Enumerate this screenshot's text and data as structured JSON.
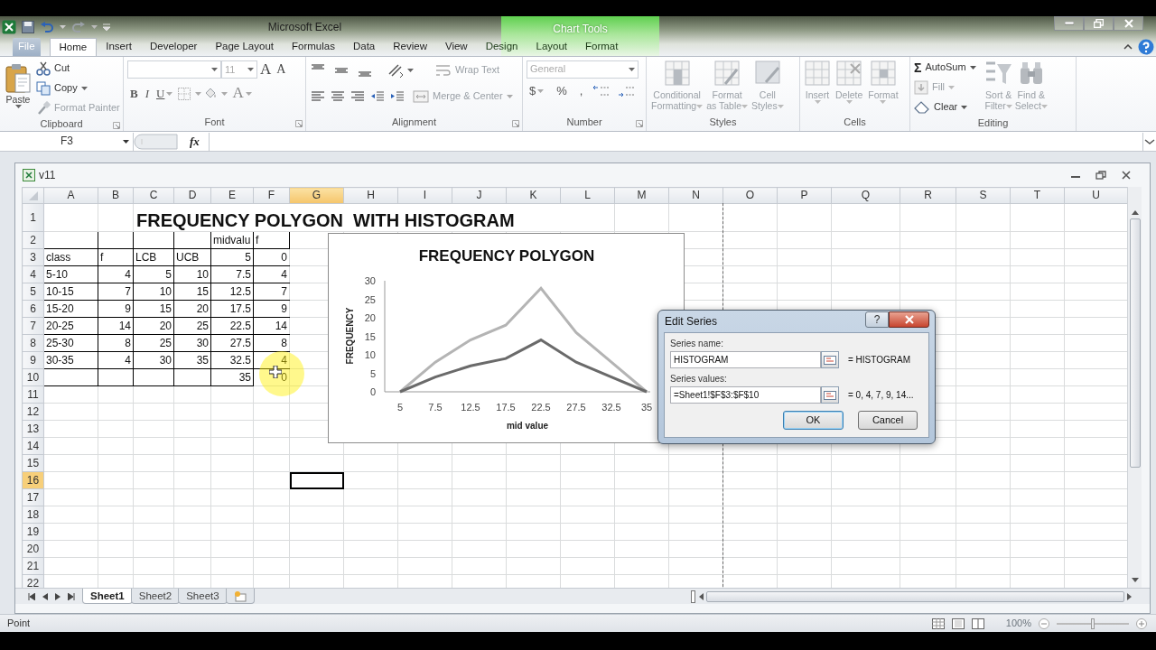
{
  "app_window": {
    "title": "Microsoft Excel",
    "context_group": "Chart Tools"
  },
  "ribbon_tabs": [
    {
      "label": "File",
      "kind": "file",
      "selected": false
    },
    {
      "label": "Home",
      "kind": "tab",
      "selected": true
    },
    {
      "label": "Insert",
      "kind": "tab",
      "selected": false
    },
    {
      "label": "Developer",
      "kind": "tab",
      "selected": false
    },
    {
      "label": "Page Layout",
      "kind": "tab",
      "selected": false
    },
    {
      "label": "Formulas",
      "kind": "tab",
      "selected": false
    },
    {
      "label": "Data",
      "kind": "tab",
      "selected": false
    },
    {
      "label": "Review",
      "kind": "tab",
      "selected": false
    },
    {
      "label": "View",
      "kind": "tab",
      "selected": false
    },
    {
      "label": "Design",
      "kind": "contextual",
      "selected": false
    },
    {
      "label": "Layout",
      "kind": "contextual",
      "selected": false
    },
    {
      "label": "Format",
      "kind": "contextual",
      "selected": false
    }
  ],
  "ribbon_groups": [
    {
      "kind": "clipboard",
      "label": "Clipboard",
      "items": [
        {
          "label": "Paste",
          "disabled": false
        },
        {
          "label": "Cut",
          "disabled": false
        },
        {
          "label": "Copy",
          "disabled": false
        },
        {
          "label": "Format Painter",
          "disabled": true
        }
      ]
    },
    {
      "kind": "font",
      "label": "Font",
      "font_size": "11",
      "items": [
        {
          "label": "A",
          "kind": "grow"
        },
        {
          "label": "A",
          "kind": "shrink"
        },
        {
          "label": "B",
          "kind": "bold"
        },
        {
          "label": "I",
          "kind": "italic"
        },
        {
          "label": "U",
          "kind": "underline"
        },
        {
          "label": "A",
          "kind": "color"
        }
      ]
    },
    {
      "kind": "alignment",
      "label": "Alignment",
      "items": [
        {
          "label": "Wrap Text",
          "disabled": true
        },
        {
          "label": "Merge & Center",
          "disabled": true
        }
      ]
    },
    {
      "kind": "number",
      "label": "Number",
      "format": "General",
      "items": [
        {
          "label": "$"
        },
        {
          "label": "%"
        },
        {
          "label": ","
        }
      ]
    },
    {
      "kind": "styles",
      "label": "Styles",
      "items": [
        {
          "label": "Conditional\nFormatting",
          "disabled": true
        },
        {
          "label": "Format\nas Table",
          "disabled": true
        },
        {
          "label": "Cell\nStyles",
          "disabled": true
        }
      ]
    },
    {
      "kind": "cells",
      "label": "Cells",
      "items": [
        {
          "label": "Insert",
          "disabled": true
        },
        {
          "label": "Delete",
          "disabled": true
        },
        {
          "label": "Format",
          "disabled": true
        }
      ]
    },
    {
      "kind": "editing",
      "label": "Editing",
      "items": [
        {
          "label": "AutoSum",
          "symbol": "Σ",
          "disabled": false
        },
        {
          "label": "Fill",
          "disabled": true
        },
        {
          "label": "Clear",
          "disabled": false
        },
        {
          "label": "Sort &\nFilter",
          "disabled": true
        },
        {
          "label": "Find &\nSelect",
          "disabled": true
        }
      ]
    }
  ],
  "formula_bar": {
    "name_box": "F3",
    "function_label": "fx"
  },
  "workbook": {
    "title": "v11",
    "columns": [
      {
        "label": "A",
        "selected": false
      },
      {
        "label": "B",
        "selected": false
      },
      {
        "label": "C",
        "selected": false
      },
      {
        "label": "D",
        "selected": false
      },
      {
        "label": "E",
        "selected": false
      },
      {
        "label": "F",
        "selected": false
      },
      {
        "label": "G",
        "selected": true
      },
      {
        "label": "H",
        "selected": false
      },
      {
        "label": "I",
        "selected": false
      },
      {
        "label": "J",
        "selected": false
      },
      {
        "label": "K",
        "selected": false
      },
      {
        "label": "L",
        "selected": false
      },
      {
        "label": "M",
        "selected": false
      },
      {
        "label": "N",
        "selected": false
      },
      {
        "label": "O",
        "selected": false
      },
      {
        "label": "P",
        "selected": false
      },
      {
        "label": "Q",
        "selected": false
      },
      {
        "label": "R",
        "selected": false
      },
      {
        "label": "S",
        "selected": false
      },
      {
        "label": "T",
        "selected": false
      },
      {
        "label": "U",
        "selected": false
      }
    ],
    "rows": [
      {
        "header": "1",
        "selected": false,
        "cells": [
          {
            "kind": "empty"
          },
          {
            "kind": "empty"
          },
          {
            "kind": "title",
            "colspan": 10,
            "text": "FREQUENCY POLYGON  WITH HISTOGRAM"
          }
        ]
      },
      {
        "header": "2",
        "selected": false,
        "cells": [
          {
            "kind": "empty",
            "boxed": true
          },
          {
            "kind": "empty",
            "boxed": true
          },
          {
            "kind": "empty",
            "boxed": true
          },
          {
            "kind": "empty",
            "boxed": true
          },
          {
            "kind": "text",
            "text": "midvalu",
            "boxed": true
          },
          {
            "kind": "text",
            "text": "f",
            "boxed": true
          }
        ]
      },
      {
        "header": "3",
        "selected": false,
        "cells": [
          {
            "kind": "text",
            "text": "class",
            "boxed": true
          },
          {
            "kind": "text",
            "text": "f",
            "boxed": true
          },
          {
            "kind": "text",
            "text": "LCB",
            "boxed": true
          },
          {
            "kind": "text",
            "text": "UCB",
            "boxed": true
          },
          {
            "kind": "number",
            "text": "5",
            "boxed": true
          },
          {
            "kind": "number",
            "text": "0",
            "boxed": true,
            "marked": true
          }
        ]
      },
      {
        "header": "4",
        "selected": false,
        "cells": [
          {
            "kind": "text",
            "text": "5-10",
            "boxed": true
          },
          {
            "kind": "number",
            "text": "4",
            "boxed": true
          },
          {
            "kind": "number",
            "text": "5",
            "boxed": true
          },
          {
            "kind": "number",
            "text": "10",
            "boxed": true
          },
          {
            "kind": "number",
            "text": "7.5",
            "boxed": true
          },
          {
            "kind": "number",
            "text": "4",
            "boxed": true,
            "marked": true
          }
        ]
      },
      {
        "header": "5",
        "selected": false,
        "cells": [
          {
            "kind": "text",
            "text": "10-15",
            "boxed": true
          },
          {
            "kind": "number",
            "text": "7",
            "boxed": true
          },
          {
            "kind": "number",
            "text": "10",
            "boxed": true
          },
          {
            "kind": "number",
            "text": "15",
            "boxed": true
          },
          {
            "kind": "number",
            "text": "12.5",
            "boxed": true
          },
          {
            "kind": "number",
            "text": "7",
            "boxed": true,
            "marked": true
          }
        ]
      },
      {
        "header": "6",
        "selected": false,
        "cells": [
          {
            "kind": "text",
            "text": "15-20",
            "boxed": true
          },
          {
            "kind": "number",
            "text": "9",
            "boxed": true
          },
          {
            "kind": "number",
            "text": "15",
            "boxed": true
          },
          {
            "kind": "number",
            "text": "20",
            "boxed": true
          },
          {
            "kind": "number",
            "text": "17.5",
            "boxed": true
          },
          {
            "kind": "number",
            "text": "9",
            "boxed": true,
            "marked": true
          }
        ]
      },
      {
        "header": "7",
        "selected": false,
        "cells": [
          {
            "kind": "text",
            "text": "20-25",
            "boxed": true
          },
          {
            "kind": "number",
            "text": "14",
            "boxed": true
          },
          {
            "kind": "number",
            "text": "20",
            "boxed": true
          },
          {
            "kind": "number",
            "text": "25",
            "boxed": true
          },
          {
            "kind": "number",
            "text": "22.5",
            "boxed": true
          },
          {
            "kind": "number",
            "text": "14",
            "boxed": true,
            "marked": true
          }
        ]
      },
      {
        "header": "8",
        "selected": false,
        "cells": [
          {
            "kind": "text",
            "text": "25-30",
            "boxed": true
          },
          {
            "kind": "number",
            "text": "8",
            "boxed": true
          },
          {
            "kind": "number",
            "text": "25",
            "boxed": true
          },
          {
            "kind": "number",
            "text": "30",
            "boxed": true
          },
          {
            "kind": "number",
            "text": "27.5",
            "boxed": true
          },
          {
            "kind": "number",
            "text": "8",
            "boxed": true,
            "marked": true
          }
        ]
      },
      {
        "header": "9",
        "selected": false,
        "cells": [
          {
            "kind": "text",
            "text": "30-35",
            "boxed": true
          },
          {
            "kind": "number",
            "text": "4",
            "boxed": true
          },
          {
            "kind": "number",
            "text": "30",
            "boxed": true
          },
          {
            "kind": "number",
            "text": "35",
            "boxed": true
          },
          {
            "kind": "number",
            "text": "32.5",
            "boxed": true
          },
          {
            "kind": "number",
            "text": "4",
            "boxed": true,
            "marked": true
          }
        ]
      },
      {
        "header": "10",
        "selected": false,
        "cells": [
          {
            "kind": "empty",
            "boxed": true
          },
          {
            "kind": "empty",
            "boxed": true
          },
          {
            "kind": "empty",
            "boxed": true
          },
          {
            "kind": "empty",
            "boxed": true
          },
          {
            "kind": "number",
            "text": "35",
            "boxed": true
          },
          {
            "kind": "number",
            "text": "0",
            "boxed": true,
            "marked": true
          }
        ]
      },
      {
        "header": "11",
        "selected": false,
        "cells": []
      },
      {
        "header": "12",
        "selected": false,
        "cells": []
      },
      {
        "header": "13",
        "selected": false,
        "cells": []
      },
      {
        "header": "14",
        "selected": false,
        "cells": []
      },
      {
        "header": "15",
        "selected": false,
        "cells": []
      },
      {
        "header": "16",
        "selected": true,
        "cells": []
      },
      {
        "header": "17",
        "selected": false,
        "cells": []
      },
      {
        "header": "18",
        "selected": false,
        "cells": []
      },
      {
        "header": "19",
        "selected": false,
        "cells": []
      },
      {
        "header": "20",
        "selected": false,
        "cells": []
      },
      {
        "header": "21",
        "selected": false,
        "cells": []
      },
      {
        "header": "22",
        "selected": false,
        "cells": []
      }
    ],
    "chart": {
      "chart_data": {
        "type": "line",
        "title": "FREQUENCY POLYGON",
        "xlabel": "mid value",
        "ylabel": "FREQUENCY",
        "categories": [
          "5",
          "7.5",
          "12.5",
          "17.5",
          "22.5",
          "27.5",
          "32.5",
          "35"
        ],
        "series": [
          {
            "color": "#b4b4b4",
            "values": [
              0,
              8,
              14,
              18,
              28,
              16,
              8,
              0
            ]
          },
          {
            "color": "#6a6a6a",
            "values": [
              0,
              4,
              7,
              9,
              14,
              8,
              4,
              0
            ]
          }
        ],
        "ylim": [
          0,
          30
        ],
        "yticks": [
          0,
          5,
          10,
          15,
          20,
          25,
          30
        ]
      }
    },
    "sheet_tabs": [
      {
        "label": "Sheet1",
        "selected": true
      },
      {
        "label": "Sheet2",
        "selected": false
      },
      {
        "label": "Sheet3",
        "selected": false
      }
    ]
  },
  "dialog": {
    "title": "Edit Series",
    "help": "?",
    "fields": [
      {
        "label": "Series name:",
        "value": "HISTOGRAM",
        "result": "= HISTOGRAM"
      },
      {
        "label": "Series values:",
        "value": "=Sheet1!$F$3:$F$10",
        "result": "= 0, 4, 7, 9, 14..."
      }
    ],
    "buttons": [
      {
        "label": "OK",
        "default": true
      },
      {
        "label": "Cancel",
        "default": false
      }
    ]
  },
  "status_bar": {
    "mode": "Point",
    "zoom": "100%",
    "zoom_slider": {
      "level": 0.5
    }
  }
}
